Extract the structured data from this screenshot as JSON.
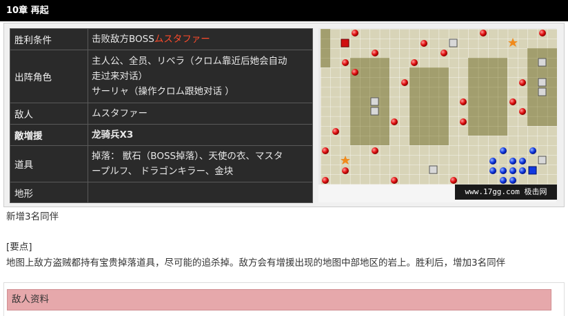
{
  "chapter": {
    "title": "10章 再起"
  },
  "info": {
    "win_label": "胜利条件",
    "win_prefix": "击败敌方BOSS",
    "win_target": "ムスタファー",
    "deploy_label": "出阵角色",
    "deploy_line1": "主人公、全员、リベラ（クロム靠近后她会自动",
    "deploy_line2": "走过来对话）",
    "deploy_line3": "サーリャ（操作クロム跟她对话 ）",
    "enemy_label": "敌人",
    "enemy_value": "ムスタファー",
    "reinforce_label": "敵増援",
    "reinforce_value": "龙骑兵X3",
    "items_label": "道具",
    "items_line1": "掉落： 獣石（BOSS掉落）、天使の衣、マスタ",
    "items_line2": "ープルフ、 ドラゴンキラー、金块",
    "terrain_label": "地形",
    "terrain_value": ""
  },
  "map": {
    "watermark": "www.17gg.com 极击网"
  },
  "notes": {
    "new_allies": "新增3名同伴",
    "key_points_label": "[要点]",
    "key_points_text": "地图上敌方盗贼都持有宝贵掉落道具，尽可能的追杀掉。敌方会有增援出现的地图中部地区的岩上。胜利后，增加3名同伴"
  },
  "enemy_section": {
    "title": "敌人资料"
  },
  "colors": {
    "header_bg": "#000000",
    "table_bg": "#2a2a2a",
    "accent_red": "#ff4b2b",
    "enemy_header_bg": "#e6a8ab",
    "map_plain": "#d8d4b8",
    "map_rock": "#a29e6e"
  }
}
